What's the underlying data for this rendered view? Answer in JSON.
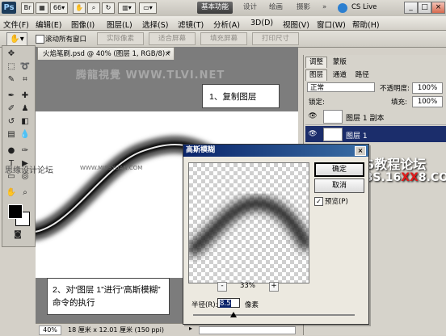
{
  "app": {
    "logo": "Ps",
    "menu": [
      "文件(F)",
      "编辑(E)",
      "图像(I)",
      "图层(L)",
      "选择(S)",
      "滤镜(T)",
      "分析(A)",
      "3D(D)",
      "视图(V)",
      "窗口(W)",
      "帮助(H)"
    ],
    "workspace": {
      "active": "基本功能",
      "others": [
        "设计",
        "绘画",
        "摄影"
      ],
      "more": "»",
      "cs_live": "CS Live"
    },
    "window_controls": [
      "_",
      "□",
      "×"
    ]
  },
  "options_bar": {
    "scroll_all_windows": "滚动所有窗口",
    "buttons": [
      "实际像素",
      "适合屏幕",
      "填充屏幕",
      "打印尺寸"
    ]
  },
  "document": {
    "tab_title": "火焰笔刷.psd @ 40% (图层 1, RGB/8) *",
    "watermark_top": "腾龍視覺 WWW.TLVI.NET",
    "watermark_left": "思缘设计论坛",
    "watermark_left_url": "WWW.MISSYUAN.COM",
    "zoom": "40%",
    "doc_info": "18 厘米 x 12.01 厘米 (150 ppi)"
  },
  "callouts": {
    "step1": "1、复制图层",
    "step2": "2、对“图层 1”进行“高斯模糊” 命令的执行"
  },
  "layers_panel": {
    "top_tabs": [
      "调整",
      "蒙版"
    ],
    "tabs": [
      "图层",
      "通道",
      "路径"
    ],
    "blend_mode": "正常",
    "opacity_label": "不透明度:",
    "opacity_value": "100%",
    "lock_label": "锁定:",
    "fill_label": "填充:",
    "fill_value": "100%",
    "layers": [
      {
        "name": "图层 1 副本",
        "selected": false
      },
      {
        "name": "图层 1",
        "selected": true
      }
    ]
  },
  "gaussian_blur_dialog": {
    "title": "高斯模糊",
    "ok": "确定",
    "cancel": "取消",
    "preview_label": "预览(P)",
    "preview_checked": true,
    "zoom_out": "-",
    "zoom_value": "33%",
    "zoom_in": "+",
    "radius_label": "半径(R):",
    "radius_value": "8.5",
    "radius_unit": "像素"
  },
  "site_watermark": {
    "title": "PS教程论坛",
    "url_prefix": "BBS.16",
    "url_highlight": "XX",
    "url_suffix": "8.COM"
  }
}
